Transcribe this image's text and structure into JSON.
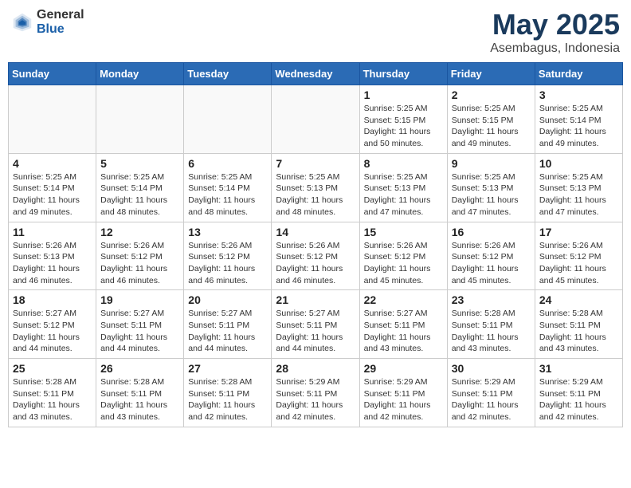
{
  "header": {
    "logo_general": "General",
    "logo_blue": "Blue",
    "month": "May 2025",
    "location": "Asembagus, Indonesia"
  },
  "days_of_week": [
    "Sunday",
    "Monday",
    "Tuesday",
    "Wednesday",
    "Thursday",
    "Friday",
    "Saturday"
  ],
  "weeks": [
    [
      {
        "day": "",
        "info": ""
      },
      {
        "day": "",
        "info": ""
      },
      {
        "day": "",
        "info": ""
      },
      {
        "day": "",
        "info": ""
      },
      {
        "day": "1",
        "info": "Sunrise: 5:25 AM\nSunset: 5:15 PM\nDaylight: 11 hours\nand 50 minutes."
      },
      {
        "day": "2",
        "info": "Sunrise: 5:25 AM\nSunset: 5:15 PM\nDaylight: 11 hours\nand 49 minutes."
      },
      {
        "day": "3",
        "info": "Sunrise: 5:25 AM\nSunset: 5:14 PM\nDaylight: 11 hours\nand 49 minutes."
      }
    ],
    [
      {
        "day": "4",
        "info": "Sunrise: 5:25 AM\nSunset: 5:14 PM\nDaylight: 11 hours\nand 49 minutes."
      },
      {
        "day": "5",
        "info": "Sunrise: 5:25 AM\nSunset: 5:14 PM\nDaylight: 11 hours\nand 48 minutes."
      },
      {
        "day": "6",
        "info": "Sunrise: 5:25 AM\nSunset: 5:14 PM\nDaylight: 11 hours\nand 48 minutes."
      },
      {
        "day": "7",
        "info": "Sunrise: 5:25 AM\nSunset: 5:13 PM\nDaylight: 11 hours\nand 48 minutes."
      },
      {
        "day": "8",
        "info": "Sunrise: 5:25 AM\nSunset: 5:13 PM\nDaylight: 11 hours\nand 47 minutes."
      },
      {
        "day": "9",
        "info": "Sunrise: 5:25 AM\nSunset: 5:13 PM\nDaylight: 11 hours\nand 47 minutes."
      },
      {
        "day": "10",
        "info": "Sunrise: 5:25 AM\nSunset: 5:13 PM\nDaylight: 11 hours\nand 47 minutes."
      }
    ],
    [
      {
        "day": "11",
        "info": "Sunrise: 5:26 AM\nSunset: 5:13 PM\nDaylight: 11 hours\nand 46 minutes."
      },
      {
        "day": "12",
        "info": "Sunrise: 5:26 AM\nSunset: 5:12 PM\nDaylight: 11 hours\nand 46 minutes."
      },
      {
        "day": "13",
        "info": "Sunrise: 5:26 AM\nSunset: 5:12 PM\nDaylight: 11 hours\nand 46 minutes."
      },
      {
        "day": "14",
        "info": "Sunrise: 5:26 AM\nSunset: 5:12 PM\nDaylight: 11 hours\nand 46 minutes."
      },
      {
        "day": "15",
        "info": "Sunrise: 5:26 AM\nSunset: 5:12 PM\nDaylight: 11 hours\nand 45 minutes."
      },
      {
        "day": "16",
        "info": "Sunrise: 5:26 AM\nSunset: 5:12 PM\nDaylight: 11 hours\nand 45 minutes."
      },
      {
        "day": "17",
        "info": "Sunrise: 5:26 AM\nSunset: 5:12 PM\nDaylight: 11 hours\nand 45 minutes."
      }
    ],
    [
      {
        "day": "18",
        "info": "Sunrise: 5:27 AM\nSunset: 5:12 PM\nDaylight: 11 hours\nand 44 minutes."
      },
      {
        "day": "19",
        "info": "Sunrise: 5:27 AM\nSunset: 5:11 PM\nDaylight: 11 hours\nand 44 minutes."
      },
      {
        "day": "20",
        "info": "Sunrise: 5:27 AM\nSunset: 5:11 PM\nDaylight: 11 hours\nand 44 minutes."
      },
      {
        "day": "21",
        "info": "Sunrise: 5:27 AM\nSunset: 5:11 PM\nDaylight: 11 hours\nand 44 minutes."
      },
      {
        "day": "22",
        "info": "Sunrise: 5:27 AM\nSunset: 5:11 PM\nDaylight: 11 hours\nand 43 minutes."
      },
      {
        "day": "23",
        "info": "Sunrise: 5:28 AM\nSunset: 5:11 PM\nDaylight: 11 hours\nand 43 minutes."
      },
      {
        "day": "24",
        "info": "Sunrise: 5:28 AM\nSunset: 5:11 PM\nDaylight: 11 hours\nand 43 minutes."
      }
    ],
    [
      {
        "day": "25",
        "info": "Sunrise: 5:28 AM\nSunset: 5:11 PM\nDaylight: 11 hours\nand 43 minutes."
      },
      {
        "day": "26",
        "info": "Sunrise: 5:28 AM\nSunset: 5:11 PM\nDaylight: 11 hours\nand 43 minutes."
      },
      {
        "day": "27",
        "info": "Sunrise: 5:28 AM\nSunset: 5:11 PM\nDaylight: 11 hours\nand 42 minutes."
      },
      {
        "day": "28",
        "info": "Sunrise: 5:29 AM\nSunset: 5:11 PM\nDaylight: 11 hours\nand 42 minutes."
      },
      {
        "day": "29",
        "info": "Sunrise: 5:29 AM\nSunset: 5:11 PM\nDaylight: 11 hours\nand 42 minutes."
      },
      {
        "day": "30",
        "info": "Sunrise: 5:29 AM\nSunset: 5:11 PM\nDaylight: 11 hours\nand 42 minutes."
      },
      {
        "day": "31",
        "info": "Sunrise: 5:29 AM\nSunset: 5:11 PM\nDaylight: 11 hours\nand 42 minutes."
      }
    ]
  ]
}
